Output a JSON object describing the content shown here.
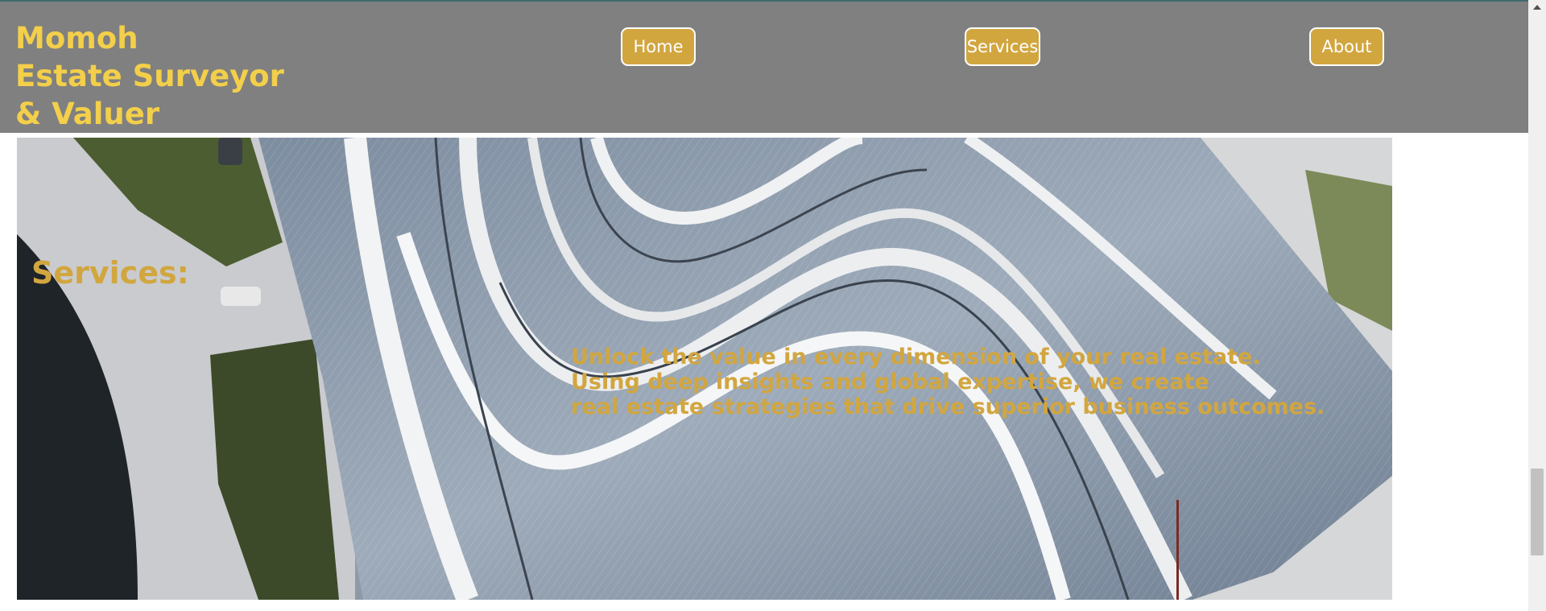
{
  "header": {
    "brand": "Momoh\nEstate Surveyor\n& Valuer",
    "nav": [
      {
        "label": "Home"
      },
      {
        "label": "Services"
      },
      {
        "label": "About"
      }
    ]
  },
  "services": {
    "title": "Services:",
    "description": "Unlock the value in every dimension of your real estate.\nUsing deep insights and global expertise, we create\nreal estate strategies that drive superior business outcomes."
  },
  "colors": {
    "header_background": "#808080",
    "brand_text": "#f3cf4a",
    "accent_gold": "#d2a63f",
    "button_border": "#ffffff"
  }
}
